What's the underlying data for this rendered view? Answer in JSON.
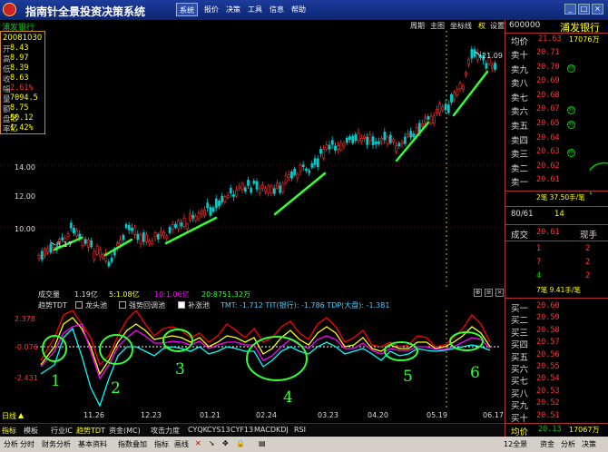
{
  "app": {
    "title": "指南针全景投资决策系统"
  },
  "menu": [
    {
      "label": "系统"
    },
    {
      "label": "报价"
    },
    {
      "label": "决策"
    },
    {
      "label": "工具"
    },
    {
      "label": "信息"
    },
    {
      "label": "帮助"
    }
  ],
  "window_buttons": {
    "minimize": "_",
    "restore": "□",
    "close": "×"
  },
  "chart_header": {
    "stock_name": "浦发银行",
    "tools": [
      "周期",
      "主图",
      "坐标线",
      "权",
      "设置"
    ]
  },
  "info_box": {
    "date": "20081030",
    "rows": [
      {
        "label": "开",
        "value": "8.43"
      },
      {
        "label": "高",
        "value": "8.97"
      },
      {
        "label": "低",
        "value": "8.39"
      },
      {
        "label": "收",
        "value": "8.63"
      },
      {
        "label": "幅",
        "value": "2.61%"
      },
      {
        "label": "量",
        "value": "7094.5"
      },
      {
        "label": "额",
        "value": "8.75亿"
      },
      {
        "label": "盘",
        "value": "50.12亿"
      },
      {
        "label": "率",
        "value": "1.42%"
      }
    ]
  },
  "price_axis": {
    "labels": [
      "14.00",
      "12.00",
      "10.00"
    ]
  },
  "annotations": {
    "low_price": "8.17",
    "high_price": "21.09"
  },
  "volume": {
    "label": "成交量",
    "total": "1.19亿",
    "ma5": "5:1.08亿",
    "ma10": "10:1.06亿",
    "ma20": "20:8751.32万"
  },
  "indicator": {
    "name": "趋势TDT",
    "options": [
      "龙头池",
      "强势回调池",
      "补涨池"
    ],
    "values": "TMT: -1.712  TIT(银行): -1.786  TDP(大盘): -1.381",
    "axis": [
      "2.378",
      "-0.076",
      "-2.431"
    ],
    "markers": [
      "1",
      "2",
      "3",
      "4",
      "5",
      "6"
    ]
  },
  "dates": [
    "11.26",
    "12.23",
    "01.21",
    "02.24",
    "03.23",
    "04.20",
    "05.19",
    "06.17"
  ],
  "date_axis": {
    "label": "日线"
  },
  "bottom_tabs": [
    "指标",
    "模板",
    "行业IC",
    "趋势TDT",
    "资金(MC)",
    "攻击力度",
    "CYQK",
    "CYS13",
    "CYF13",
    "MACD",
    "KDJ",
    "RSI"
  ],
  "statusbar": {
    "left": [
      "分析",
      "分时",
      "财务分析",
      "基本资料",
      "指数叠加",
      "指标",
      "画线"
    ],
    "right": [
      "12全景",
      "资金",
      "分析",
      "决策"
    ]
  },
  "right_panel": {
    "code": "600000",
    "name": "浦发银行",
    "avg": {
      "label": "均价",
      "price": "21.63",
      "vol": "17076万"
    },
    "asks": [
      {
        "label": "卖十",
        "price": "20.71",
        "vol": ""
      },
      {
        "label": "卖九",
        "price": "20.70",
        "vol": "",
        "tick": true
      },
      {
        "label": "卖八",
        "price": "20.69",
        "vol": ""
      },
      {
        "label": "卖七",
        "price": "20.68",
        "vol": ""
      },
      {
        "label": "卖六",
        "price": "20.67",
        "vol": "",
        "tick": true
      },
      {
        "label": "卖五",
        "price": "20.65",
        "vol": "",
        "tick": true
      },
      {
        "label": "卖四",
        "price": "20.64",
        "vol": ""
      },
      {
        "label": "卖三",
        "price": "20.63",
        "vol": "",
        "tick": true
      },
      {
        "label": "卖二",
        "price": "20.62",
        "vol": ""
      },
      {
        "label": "卖一",
        "price": "20.61",
        "vol": ""
      }
    ],
    "stat1": "2笔 37.50手/笔",
    "ratio": {
      "a": "80/61",
      "b": "14"
    },
    "trade": {
      "label": "成交",
      "price": "20.61",
      "label2": "现手"
    },
    "trade_nums": [
      {
        "v": "1"
      },
      {
        "v": "2"
      },
      {
        "v": "7"
      },
      {
        "v": "2"
      },
      {
        "v": "4"
      },
      {
        "v": "2"
      }
    ],
    "stat2": "7笔 9.41手/笔",
    "bids": [
      {
        "label": "买一",
        "price": "20.60"
      },
      {
        "label": "买二",
        "price": "20.59"
      },
      {
        "label": "买三",
        "price": "20.58"
      },
      {
        "label": "买四",
        "price": "20.57"
      },
      {
        "label": "买五",
        "price": "20.56"
      },
      {
        "label": "买六",
        "price": "20.55"
      },
      {
        "label": "买七",
        "price": "20.54"
      },
      {
        "label": "买八",
        "price": "20.53"
      },
      {
        "label": "买九",
        "price": "20.52"
      },
      {
        "label": "买十",
        "price": "20.51"
      }
    ],
    "avg2": {
      "label": "均价",
      "price": "20.13",
      "vol": "17067万"
    }
  }
}
